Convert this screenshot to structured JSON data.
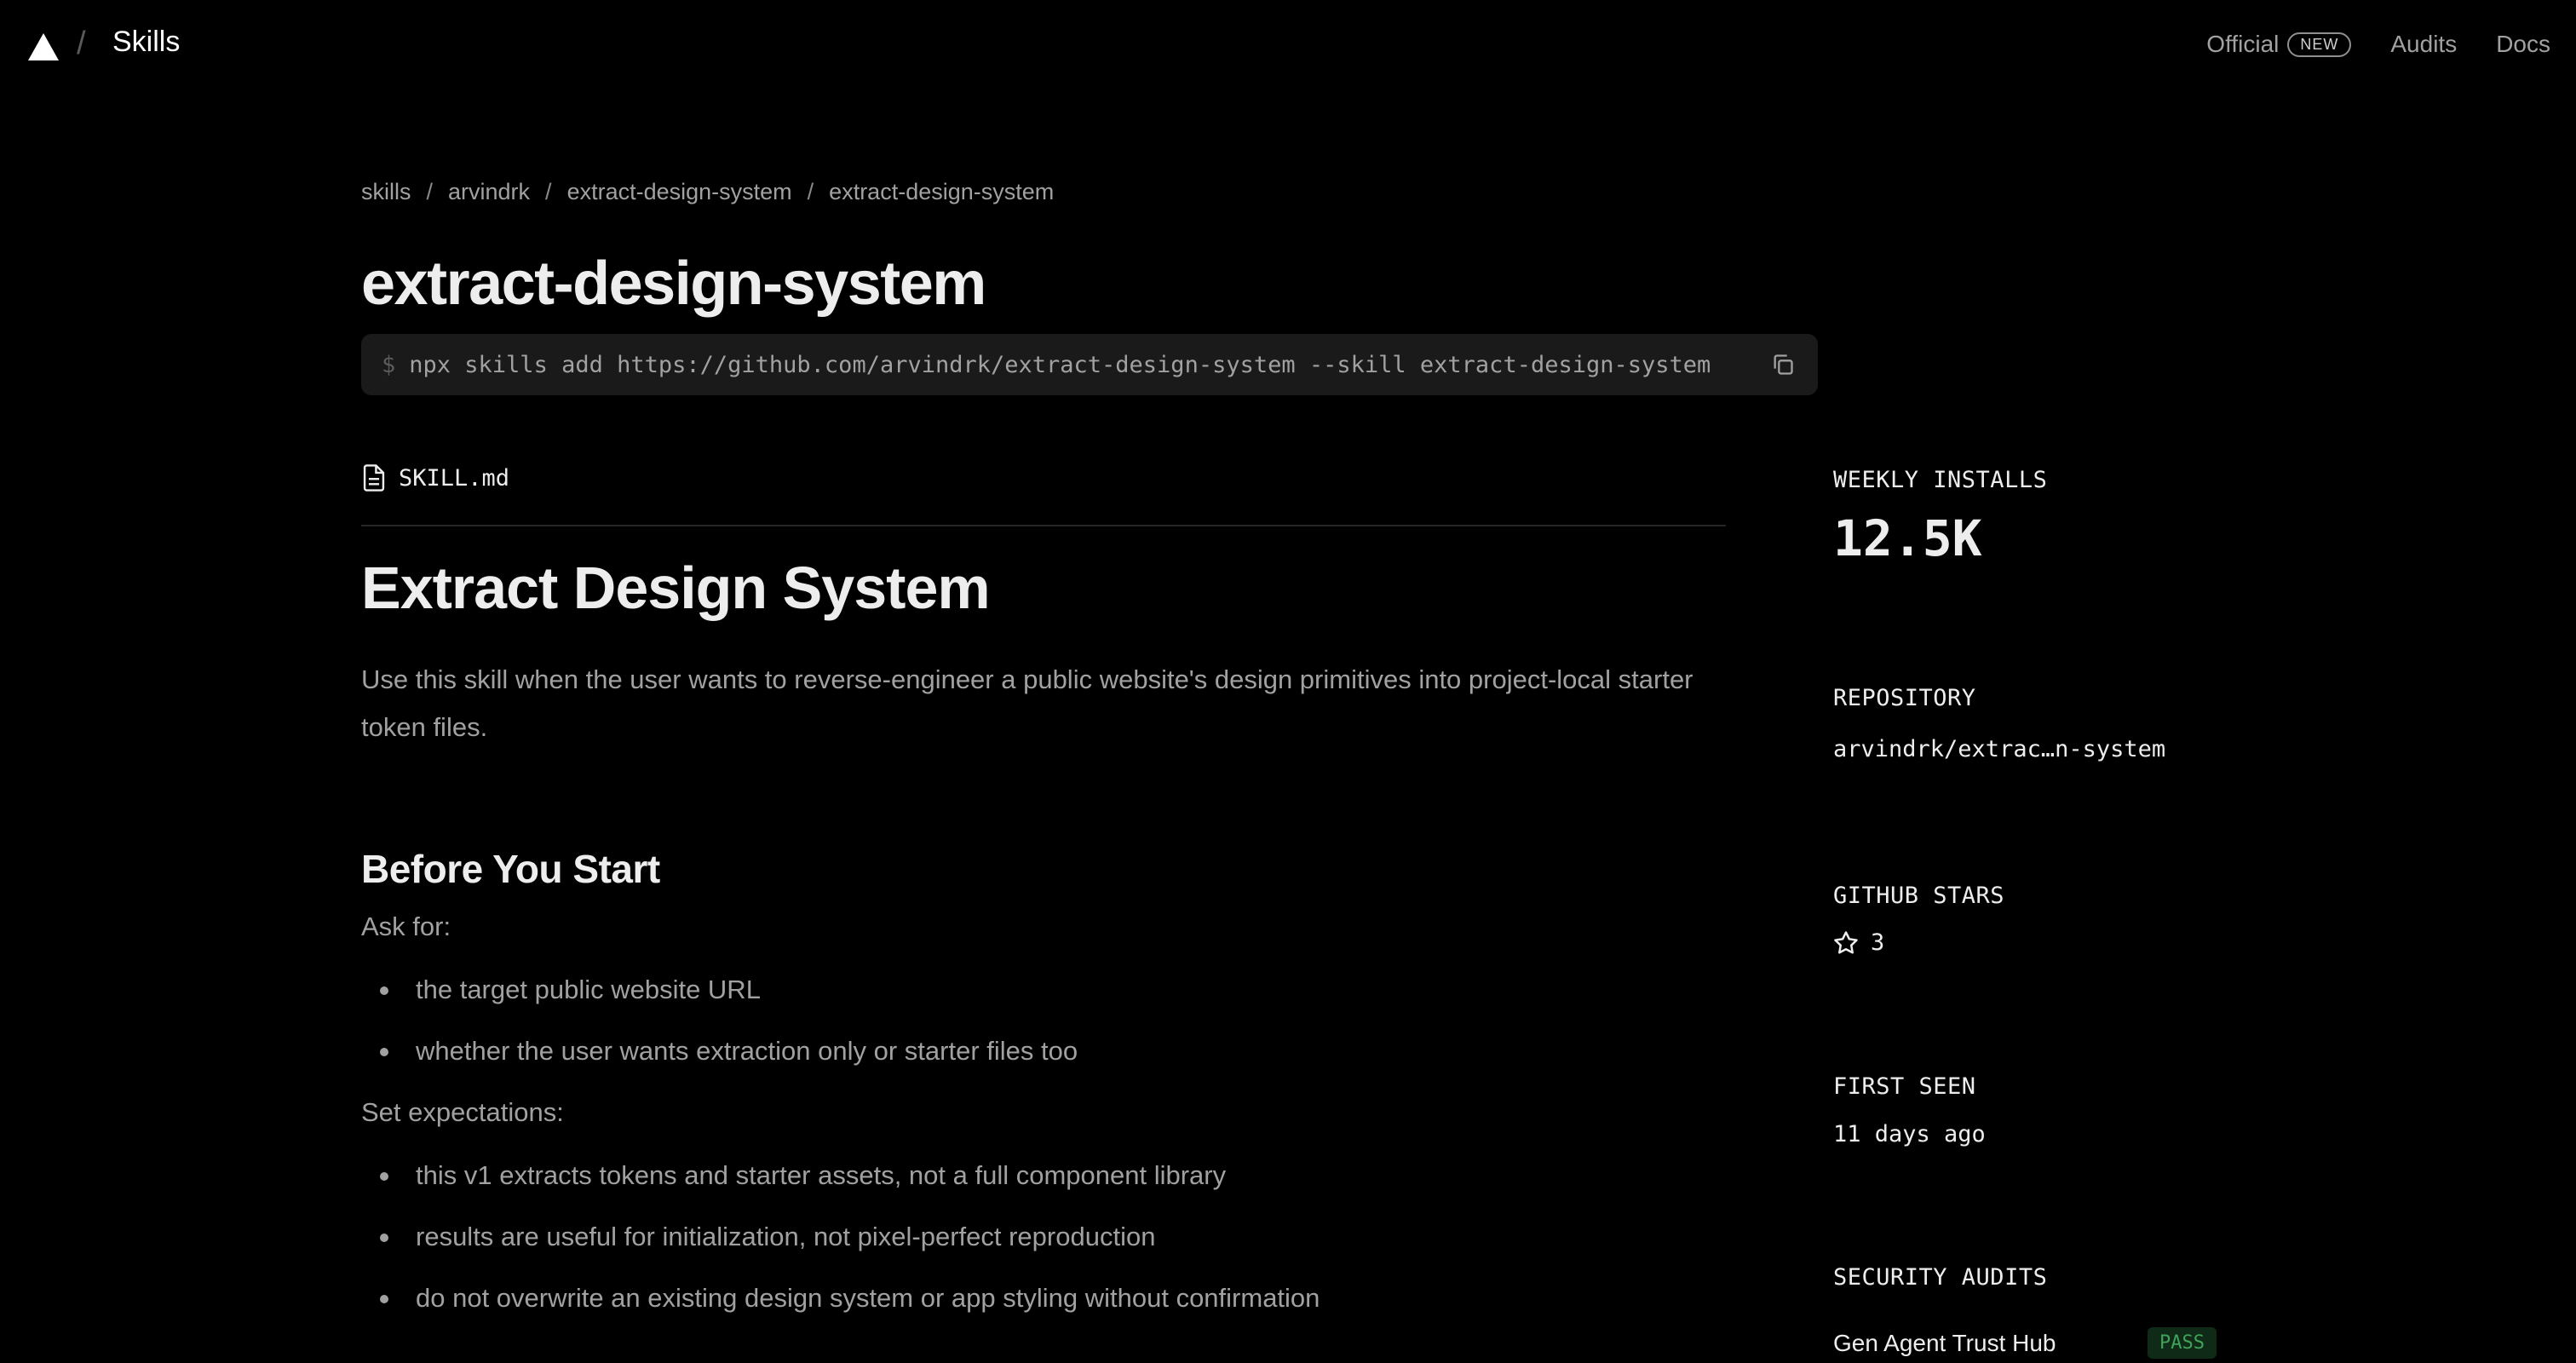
{
  "nav": {
    "title": "Skills",
    "separator": "/",
    "links": {
      "official": "Official",
      "official_badge": "NEW",
      "audits": "Audits",
      "docs": "Docs"
    }
  },
  "breadcrumb": [
    "skills",
    "arvindrk",
    "extract-design-system",
    "extract-design-system"
  ],
  "breadcrumb_separator": "/",
  "page_title": "extract-design-system",
  "install": {
    "prompt": "$",
    "command": "npx skills add https://github.com/arvindrk/extract-design-system --skill extract-design-system",
    "copy_icon": "copy-icon"
  },
  "file_tab": {
    "icon": "file-icon",
    "name": "SKILL.md"
  },
  "article": {
    "h1": "Extract Design System",
    "lead": "Use this skill when the user wants to reverse-engineer a public website's design primitives into project-local starter token files.",
    "section_title": "Before You Start",
    "ask_for_label": "Ask for:",
    "ask_for_items": [
      "the target public website URL",
      "whether the user wants extraction only or starter files too"
    ],
    "set_expectations_label": "Set expectations:",
    "set_expectations_items": [
      "this v1 extracts tokens and starter assets, not a full component library",
      "results are useful for initialization, not pixel-perfect reproduction",
      "do not overwrite an existing design system or app styling without confirmation"
    ]
  },
  "sidebar": {
    "weekly_installs_label": "WEEKLY INSTALLS",
    "weekly_installs_value": "12.5K",
    "repository_label": "REPOSITORY",
    "repository_value": "arvindrk/extrac…n-system",
    "github_stars_label": "GITHUB STARS",
    "github_stars_value": "3",
    "first_seen_label": "FIRST SEEN",
    "first_seen_value": "11 days ago",
    "security_audits_label": "SECURITY AUDITS",
    "audits": [
      {
        "name": "Gen Agent Trust Hub",
        "status": "PASS"
      }
    ]
  },
  "colors": {
    "background": "#000000",
    "text_primary": "#ededed",
    "text_muted": "#a1a1a1",
    "code_bg": "#1a1a1a",
    "pass_green": "#3fa35a"
  }
}
